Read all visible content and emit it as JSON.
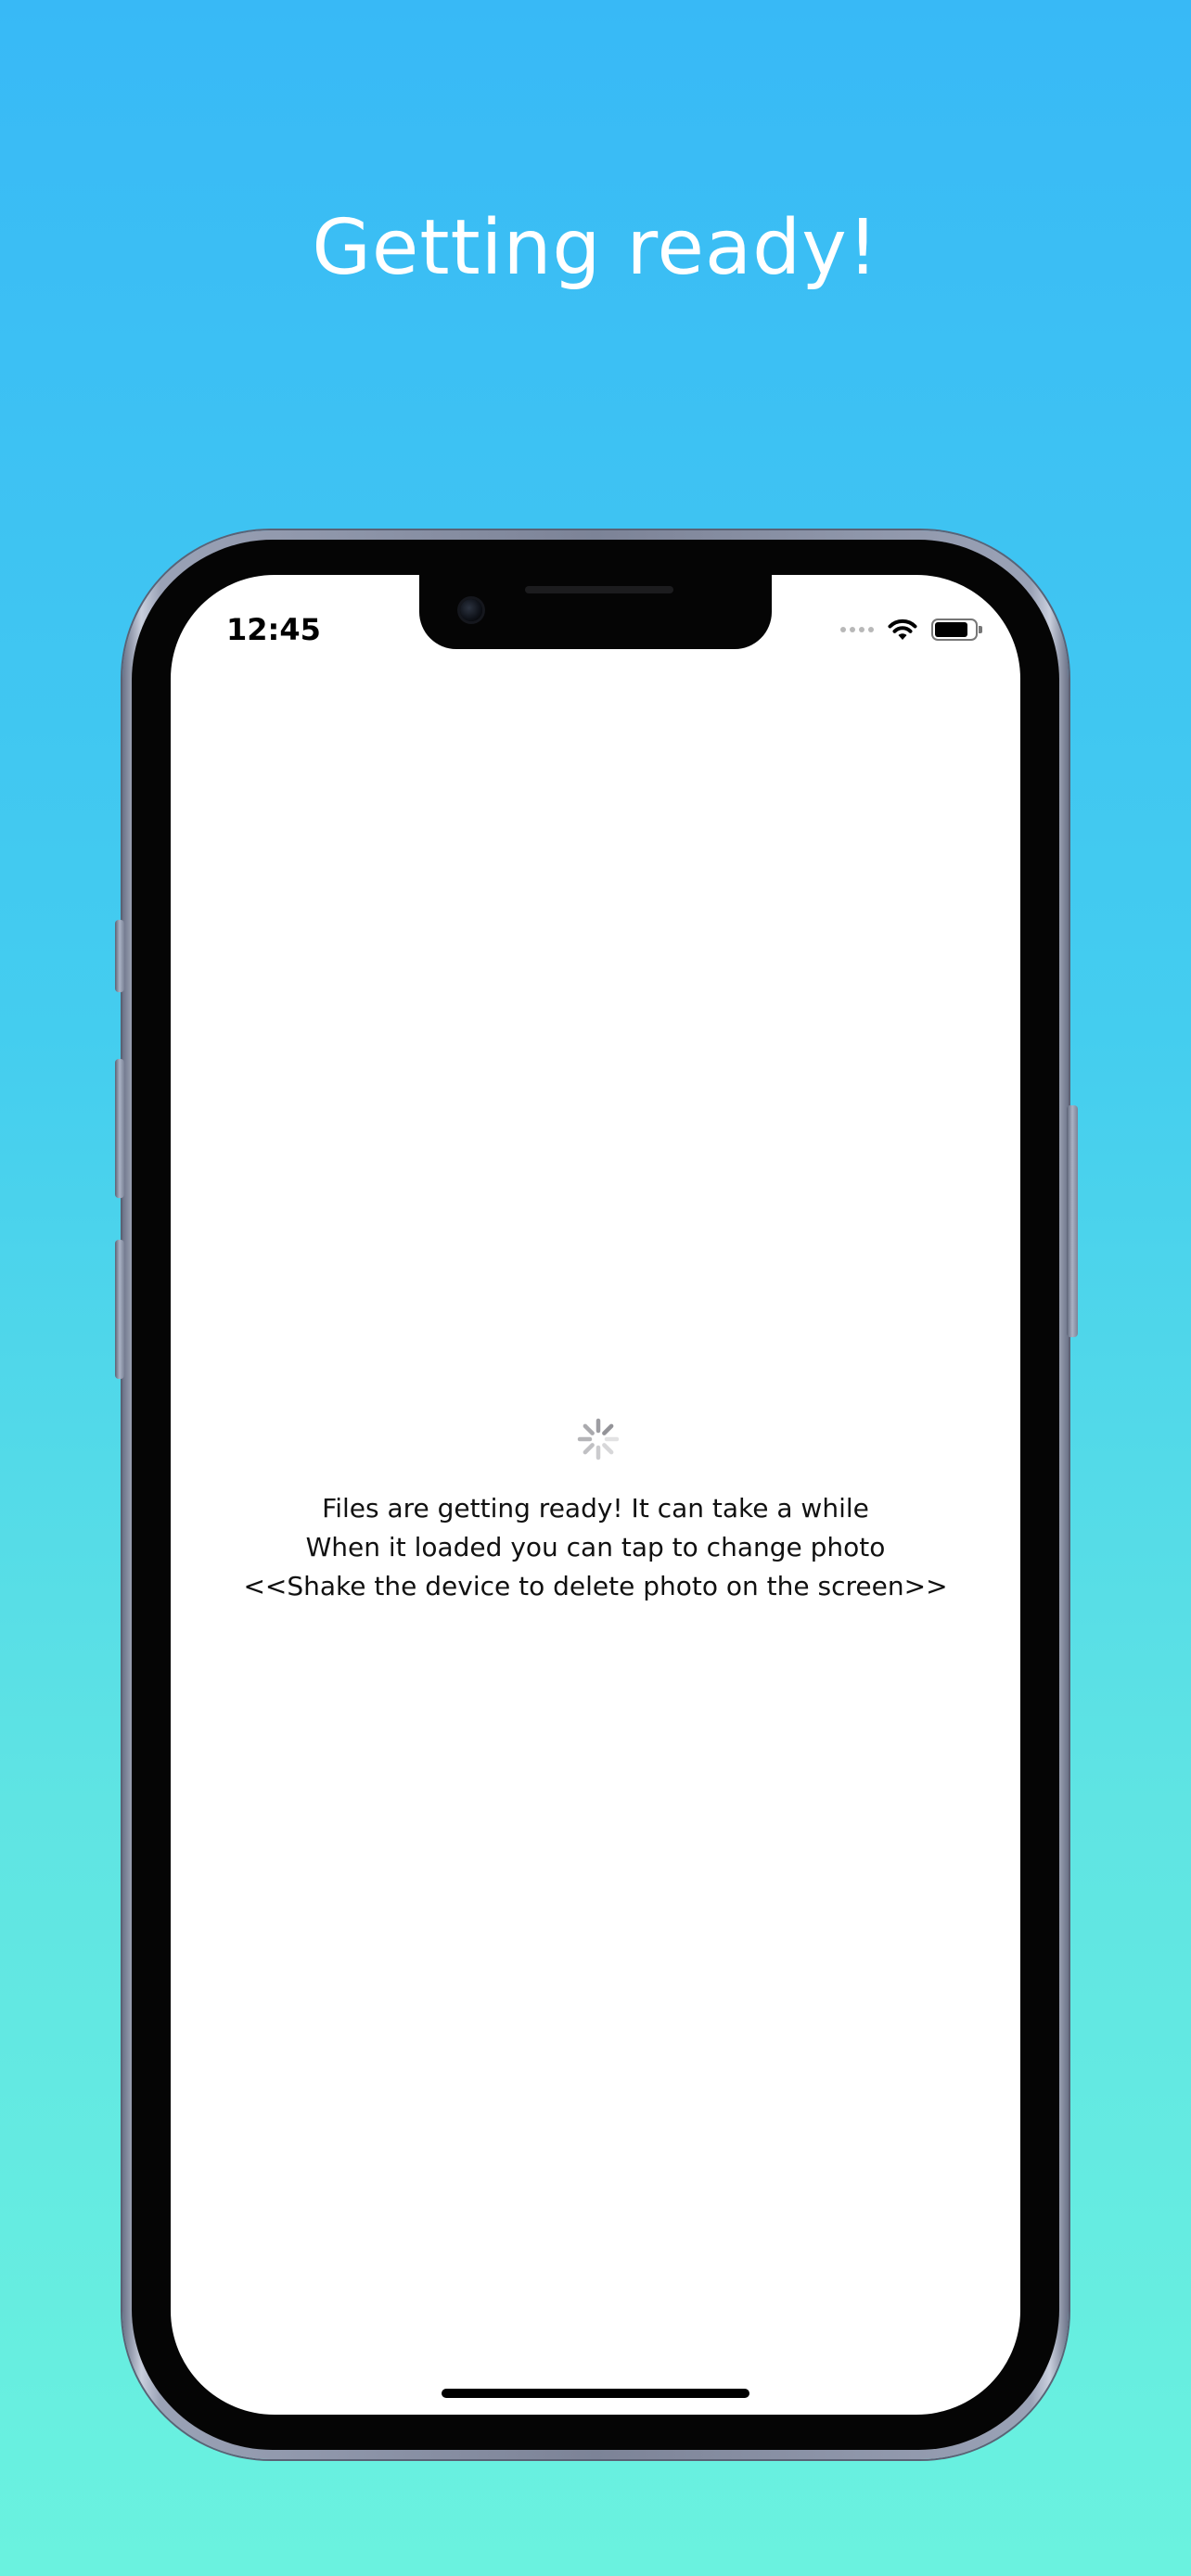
{
  "headline": "Getting ready!",
  "status_bar": {
    "time": "12:45",
    "icons": [
      "signal-dots-icon",
      "wifi-icon",
      "battery-icon"
    ],
    "battery_level": 0.85
  },
  "loading": {
    "spinner_icon": "activity-spinner-icon",
    "lines": [
      "Files are getting ready! It can take a while",
      "When it loaded you can tap to change photo",
      "<<Shake the device to delete photo on the screen>>"
    ]
  },
  "colors": {
    "background_top": "#38b9f6",
    "background_bottom": "#6af2df",
    "headline_text": "#ffffff",
    "screen_bg": "#ffffff"
  }
}
